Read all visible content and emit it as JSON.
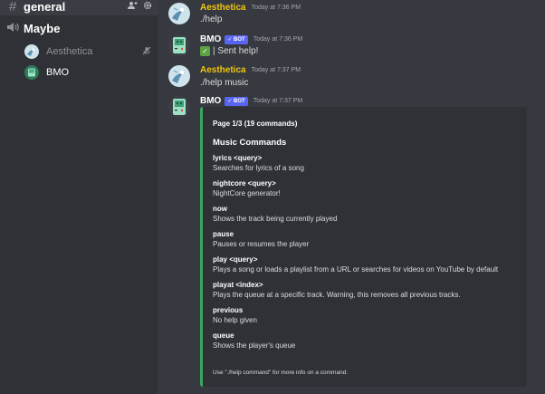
{
  "sidebar": {
    "text_channel": "general",
    "voice_channel": "Maybe",
    "voice_users": [
      {
        "name": "Aesthetica"
      },
      {
        "name": "BMO"
      }
    ]
  },
  "messages": [
    {
      "author": "Aesthetica",
      "timestamp": "Today at 7:36 PM",
      "content": "./help"
    },
    {
      "author": "BMO",
      "bot_tag": "✓ BOT",
      "timestamp": "Today at 7:36 PM",
      "content": "| Sent help!"
    },
    {
      "author": "Aesthetica",
      "timestamp": "Today at 7:37 PM",
      "content": "./help music"
    },
    {
      "author": "BMO",
      "bot_tag": "✓ BOT",
      "timestamp": "Today at 7:37 PM"
    }
  ],
  "embed": {
    "page": "Page 1/3 (19 commands)",
    "title": "Music Commands",
    "fields": [
      {
        "name": "lyrics <query>",
        "value": "Searches for lyrics of a song"
      },
      {
        "name": "nightcore <query>",
        "value": "NightCore generator!"
      },
      {
        "name": "now",
        "value": "Shows the track being currently played"
      },
      {
        "name": "pause",
        "value": "Pauses or resumes the player"
      },
      {
        "name": "play <query>",
        "value": "Plays a song or loads a playlist from a URL or searches for videos on YouTube by default"
      },
      {
        "name": "playat <index>",
        "value": "Plays the queue at a specific track. Warning, this removes all previous tracks."
      },
      {
        "name": "previous",
        "value": "No help given"
      },
      {
        "name": "queue",
        "value": "Shows the player's queue"
      }
    ],
    "footer": "Use \"./help command\" for more info on a command."
  },
  "colors": {
    "accent_embed": "#3ba55c",
    "aesthetica_name": "#f1c40f",
    "bot_tag": "#5865f2"
  },
  "icons": {
    "text_channel": "hash-icon",
    "voice_channel": "speaker-icon",
    "add_member": "add-member-icon",
    "settings": "gear-icon",
    "muted": "microphone-muted-icon",
    "checkmark": "check-emoji-icon"
  }
}
